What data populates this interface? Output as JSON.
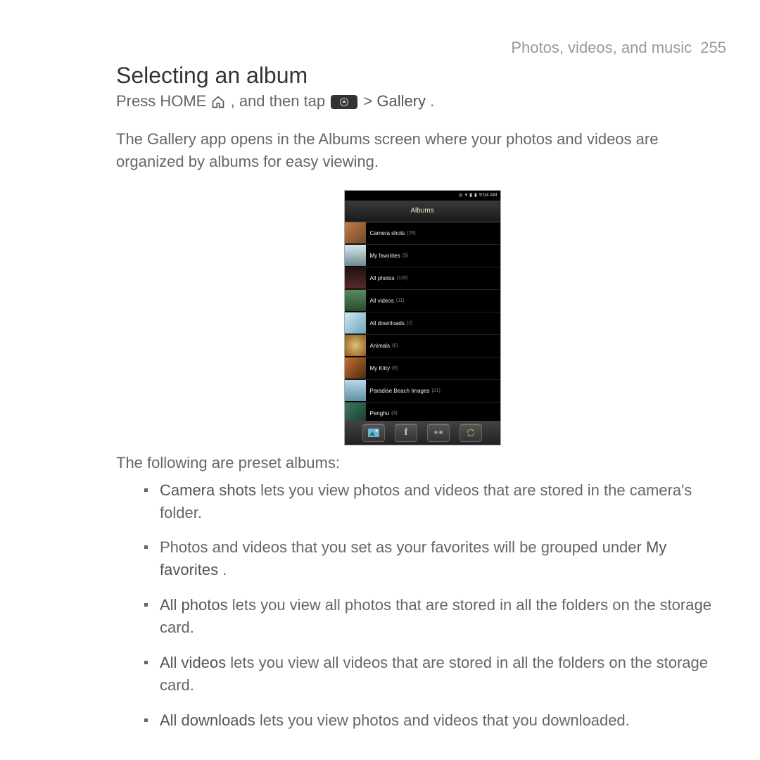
{
  "header": {
    "section": "Photos, videos, and music",
    "page": "255"
  },
  "title": "Selecting an album",
  "instruction": {
    "p1": "Press HOME ",
    "p2": ", and then tap ",
    "p3": " > ",
    "gallery": "Gallery",
    "p4": "."
  },
  "intro": "The Gallery app opens in the Albums screen where your photos and videos are organized by albums for easy viewing.",
  "phone": {
    "time": "9:04 AM",
    "header": "Albums",
    "albums": [
      {
        "name": "Camera shots",
        "count": "(26)"
      },
      {
        "name": "My favorites",
        "count": "(5)"
      },
      {
        "name": "All photos",
        "count": "(116)"
      },
      {
        "name": "All videos",
        "count": "(11)"
      },
      {
        "name": "All downloads",
        "count": "(2)"
      },
      {
        "name": "Animals",
        "count": "(6)"
      },
      {
        "name": "My Kitty",
        "count": "(6)"
      },
      {
        "name": "Paradise Beach Images",
        "count": "(21)"
      },
      {
        "name": "Penghu",
        "count": "(4)"
      }
    ]
  },
  "presets_intro": "The following are preset albums:",
  "presets": [
    {
      "bold": "Camera shots",
      "text": " lets you view photos and videos that are stored in the camera's folder."
    },
    {
      "pre": "Photos and videos that you set as your favorites will be grouped under ",
      "bold": "My favorites",
      "post": "."
    },
    {
      "bold": "All photos",
      "text": " lets you view all photos that are stored in all the folders on the storage card."
    },
    {
      "bold": "All videos",
      "text": " lets you view all videos that are stored in all the folders on the storage card."
    },
    {
      "bold": "All downloads",
      "text": " lets you view photos and videos that you downloaded."
    }
  ]
}
